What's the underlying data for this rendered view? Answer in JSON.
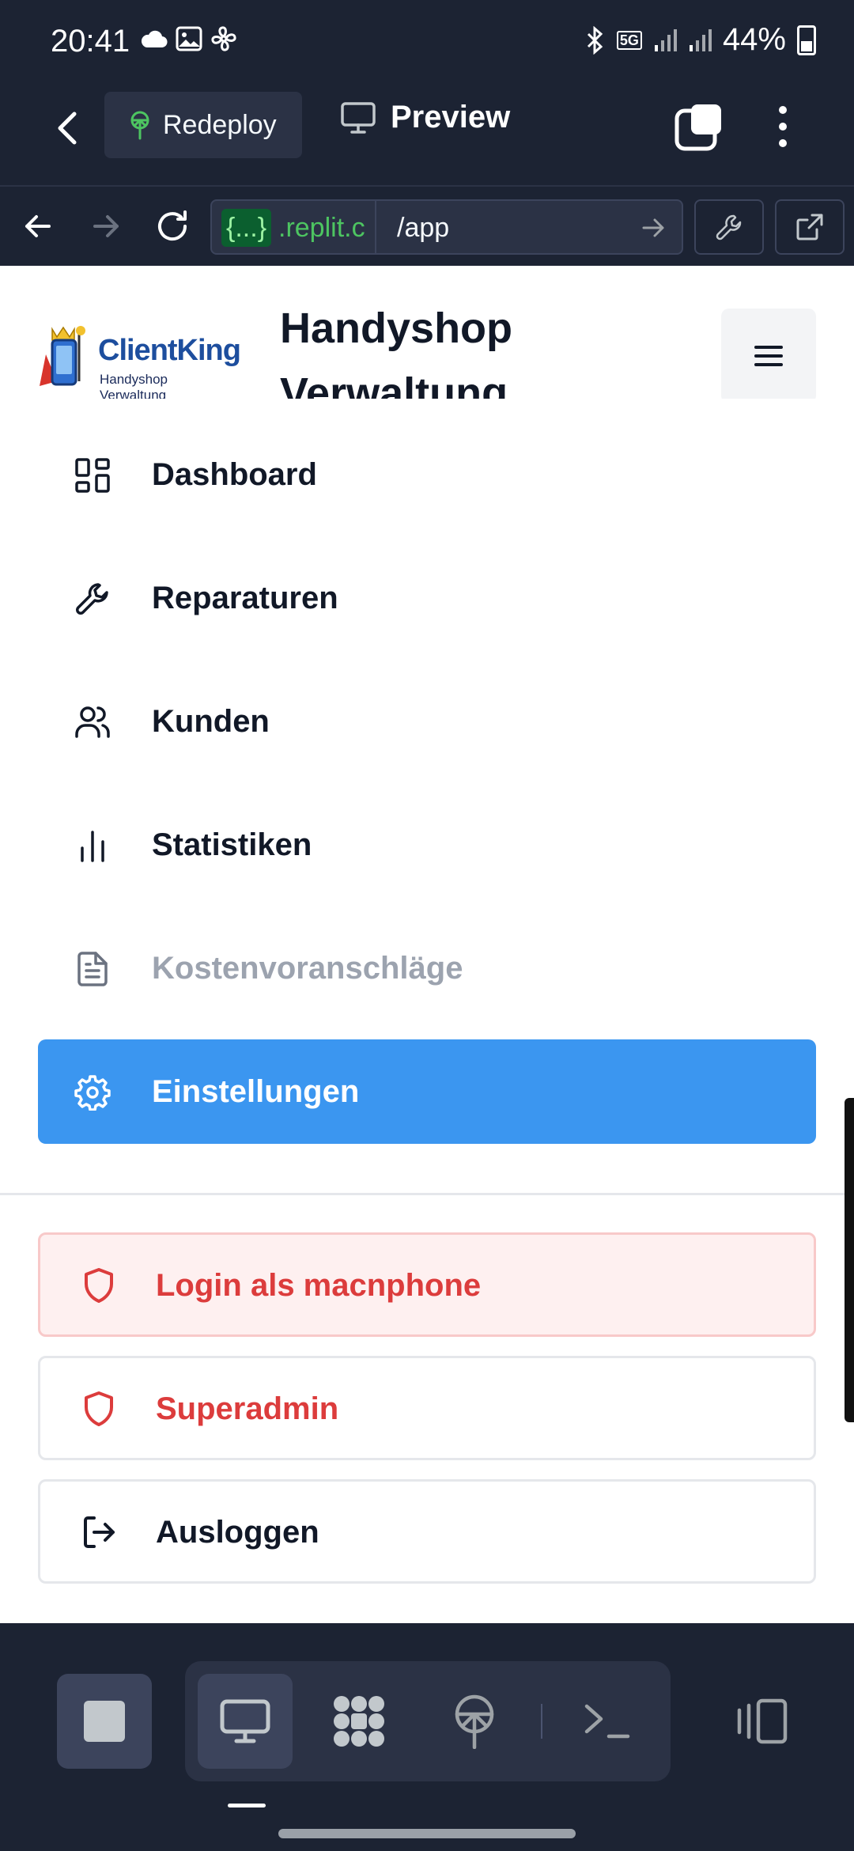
{
  "status_bar": {
    "time": "20:41",
    "network": "5G",
    "battery": "44%",
    "icons": [
      "cloud-icon",
      "image-icon",
      "fan-icon",
      "bluetooth-icon",
      "signal-icon",
      "signal-icon",
      "battery-icon"
    ]
  },
  "replit_toolbar": {
    "redeploy_label": "Redeploy",
    "preview_label": "Preview"
  },
  "url_bar": {
    "chip_text": "{...}",
    "host_text": ".replit.c",
    "path_text": "/app"
  },
  "app": {
    "logo_title": "ClientKing",
    "logo_subtitle": "Handyshop Verwaltung",
    "title": "Handyshop Verwaltung",
    "menu": [
      {
        "label": "Dashboard",
        "icon": "dashboard-icon",
        "state": "normal"
      },
      {
        "label": "Reparaturen",
        "icon": "wrench-icon",
        "state": "normal"
      },
      {
        "label": "Kunden",
        "icon": "users-icon",
        "state": "normal"
      },
      {
        "label": "Statistiken",
        "icon": "bar-chart-icon",
        "state": "normal"
      },
      {
        "label": "Kostenvoranschläge",
        "icon": "document-icon",
        "state": "disabled"
      },
      {
        "label": "Einstellungen",
        "icon": "gear-icon",
        "state": "active"
      }
    ],
    "actions": {
      "login_as": "Login als macnphone",
      "superadmin": "Superadmin",
      "logout": "Ausloggen"
    }
  },
  "colors": {
    "replit_bg": "#1c2333",
    "active_menu": "#3b96f0",
    "danger_text": "#dc3c3c",
    "danger_bg": "#fef0f0"
  }
}
